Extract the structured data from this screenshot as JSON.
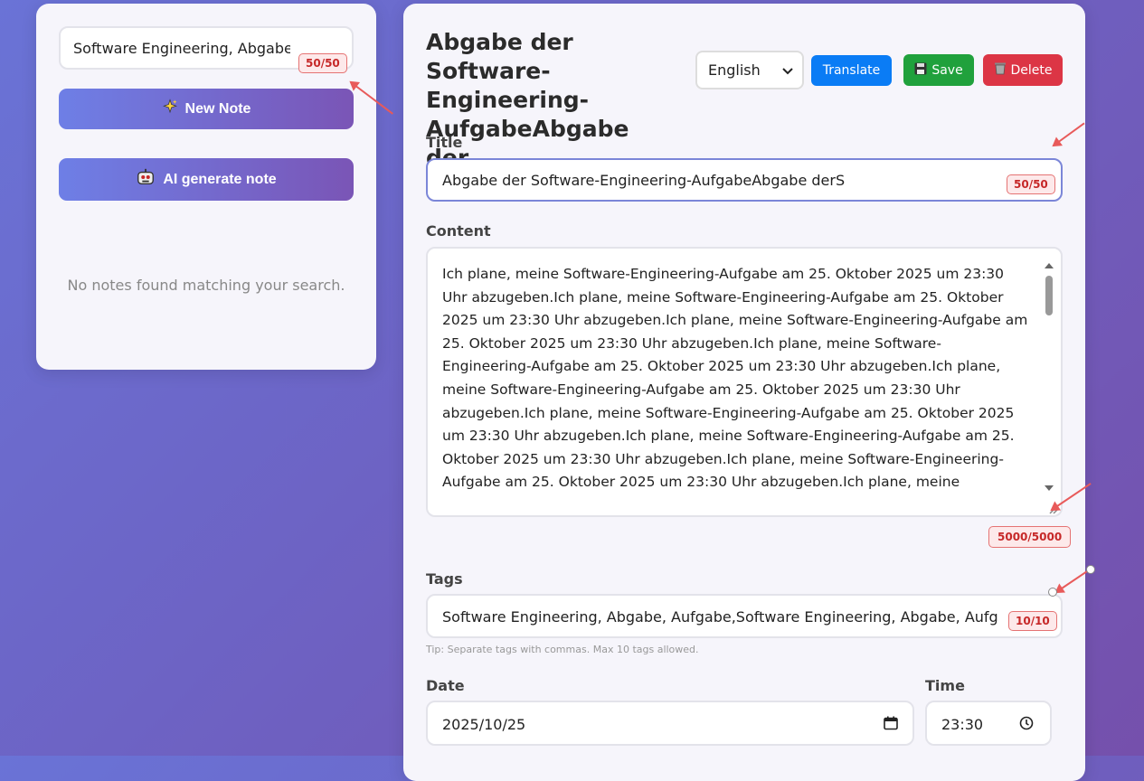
{
  "sidebar": {
    "search_value": "Software Engineering, Abgabe, Aufgabe",
    "search_counter": "50/50",
    "new_note_label": "New Note",
    "new_note_icon": "sparkles-icon",
    "ai_note_label": "AI generate note",
    "ai_note_icon": "robot-icon",
    "empty_message": "No notes found matching your search."
  },
  "editor": {
    "heading": "Abgabe der Software-Engineering-AufgabeAbgabe der",
    "language_selected": "English",
    "translate_label": "Translate",
    "save_label": "Save",
    "delete_label": "Delete",
    "title_label": "Title",
    "title_value": "Abgabe der Software-Engineering-AufgabeAbgabe derS",
    "title_counter": "50/50",
    "content_label": "Content",
    "content_value": "Ich plane, meine Software-Engineering-Aufgabe am 25. Oktober 2025 um 23:30 Uhr abzugeben.Ich plane, meine Software-Engineering-Aufgabe am 25. Oktober 2025 um 23:30 Uhr abzugeben.Ich plane, meine Software-Engineering-Aufgabe am 25. Oktober 2025 um 23:30 Uhr abzugeben.Ich plane, meine Software-Engineering-Aufgabe am 25. Oktober 2025 um 23:30 Uhr abzugeben.Ich plane, meine Software-Engineering-Aufgabe am 25. Oktober 2025 um 23:30 Uhr abzugeben.Ich plane, meine Software-Engineering-Aufgabe am 25. Oktober 2025 um 23:30 Uhr abzugeben.Ich plane, meine Software-Engineering-Aufgabe am 25. Oktober 2025 um 23:30 Uhr abzugeben.Ich plane, meine Software-Engineering-Aufgabe am 25. Oktober 2025 um 23:30 Uhr abzugeben.Ich plane, meine",
    "content_counter": "5000/5000",
    "tags_label": "Tags",
    "tags_value": "Software Engineering, Abgabe, Aufgabe,Software Engineering, Abgabe, Aufgabe,Software",
    "tags_counter": "10/10",
    "tags_tip": "Tip: Separate tags with commas. Max 10 tags allowed.",
    "date_label": "Date",
    "date_value": "2025/10/25",
    "time_label": "Time",
    "time_value": "23:30"
  },
  "colors": {
    "translate": "#0a7cf5",
    "save": "#20a13c",
    "delete": "#dc3545",
    "focus_border": "#7b86d8",
    "counter_red": "#c62828"
  }
}
